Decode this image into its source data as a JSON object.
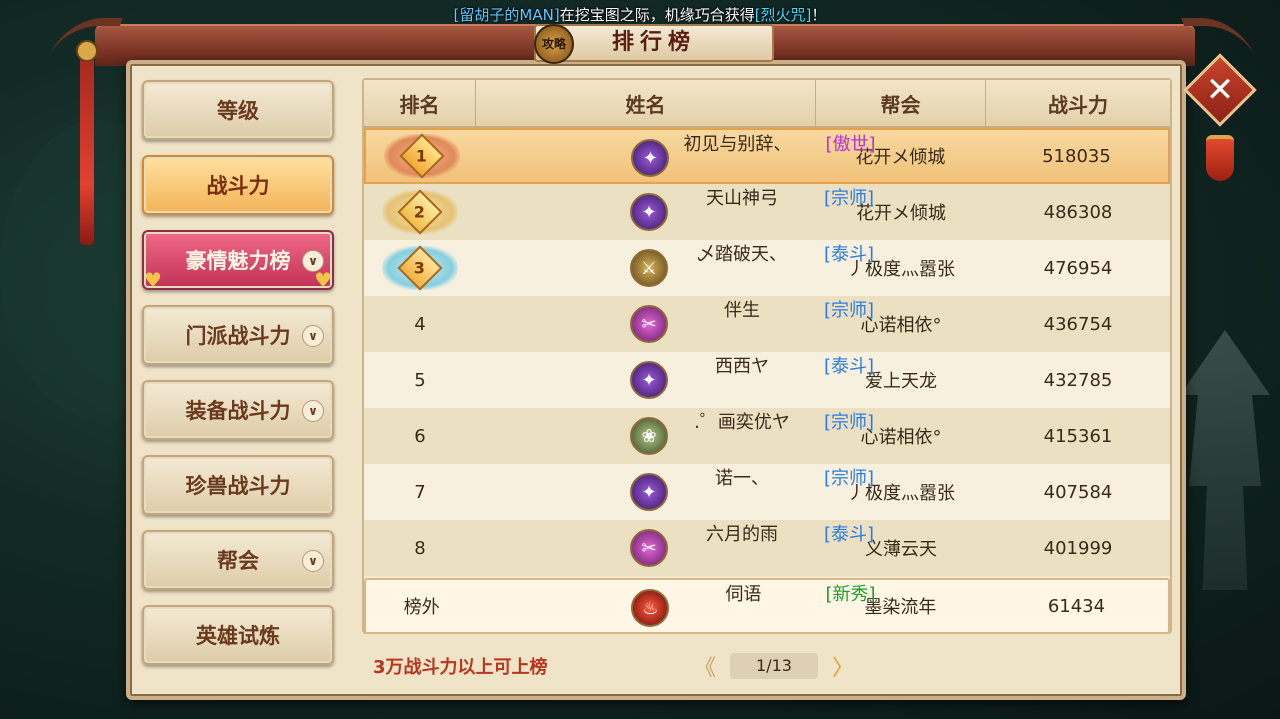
{
  "announcement": {
    "part1": "[留胡子的MAN]",
    "part2": "在挖宝图之际，机缘巧合获得",
    "part3": "[烈火咒]",
    "part4": "！"
  },
  "window": {
    "title": "排行榜",
    "guide_badge": "攻略",
    "close_icon": "close-icon"
  },
  "sidebar": {
    "items": [
      {
        "label": "等级",
        "state": "normal",
        "has_dropdown": false
      },
      {
        "label": "战斗力",
        "state": "active",
        "has_dropdown": false
      },
      {
        "label": "豪情魅力榜",
        "state": "pink",
        "has_dropdown": true
      },
      {
        "label": "门派战斗力",
        "state": "normal",
        "has_dropdown": true
      },
      {
        "label": "装备战斗力",
        "state": "normal",
        "has_dropdown": true
      },
      {
        "label": "珍兽战斗力",
        "state": "normal",
        "has_dropdown": false
      },
      {
        "label": "帮会",
        "state": "normal",
        "has_dropdown": true
      },
      {
        "label": "英雄试炼",
        "state": "normal",
        "has_dropdown": false
      }
    ]
  },
  "table": {
    "headers": [
      "排名",
      "姓名",
      "帮会",
      "战斗力"
    ],
    "rows": [
      {
        "rank": "1",
        "name": "初见与别辞、",
        "tag": "[傲世]",
        "guild": "花开メ倾城",
        "power": "518035"
      },
      {
        "rank": "2",
        "name": "天山神弓",
        "tag": "[宗师]",
        "guild": "花开メ倾城",
        "power": "486308"
      },
      {
        "rank": "3",
        "name": "乄踏破天、",
        "tag": "[泰斗]",
        "guild": "丿极度灬嚣张",
        "power": "476954"
      },
      {
        "rank": "4",
        "name": "伴生",
        "tag": "[宗师]",
        "guild": "心诺相依°",
        "power": "436754"
      },
      {
        "rank": "5",
        "name": "西西ヤ",
        "tag": "[泰斗]",
        "guild": "爱上天龙",
        "power": "432785"
      },
      {
        "rank": "6",
        "name": ".゜画奕优ヤ",
        "tag": "[宗师]",
        "guild": "心诺相依°",
        "power": "415361"
      },
      {
        "rank": "7",
        "name": "诺一、",
        "tag": "[宗师]",
        "guild": "丿极度灬嚣张",
        "power": "407584"
      },
      {
        "rank": "8",
        "name": "六月的雨",
        "tag": "[泰斗]",
        "guild": "义薄云天",
        "power": "401999"
      }
    ],
    "self_row": {
      "rank": "榜外",
      "name": "伺语",
      "tag": "[新秀]",
      "guild": "墨染流年",
      "power": "61434"
    }
  },
  "footer": {
    "note": "3万战斗力以上可上榜",
    "page": "1/13"
  },
  "colors": {
    "tag_purple": "#b333d8",
    "tag_blue": "#2a7de0",
    "tag_green": "#1e9e2a",
    "footer_red": "#b8361e"
  }
}
